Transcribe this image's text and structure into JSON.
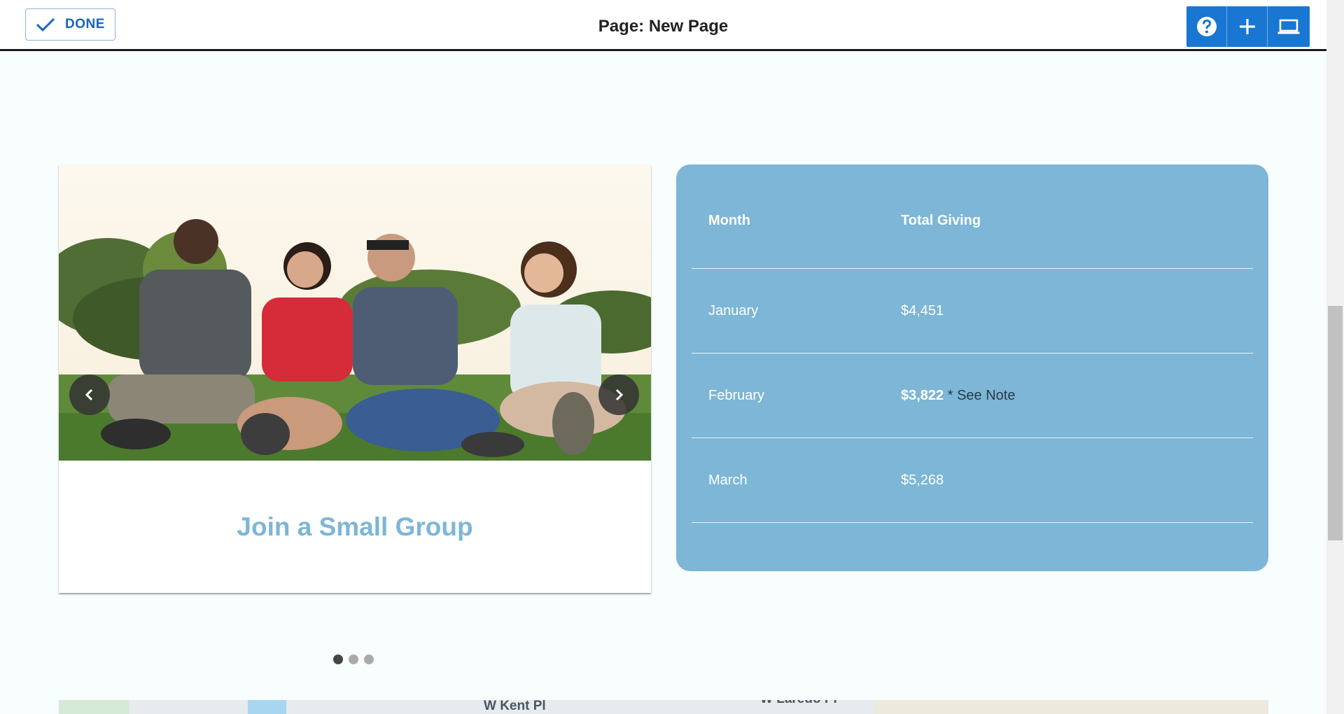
{
  "topbar": {
    "done_label": "DONE",
    "page_title": "Page: New Page",
    "tools": [
      "help-icon",
      "add-icon",
      "desktop-preview-icon"
    ],
    "accent_color": "#1976d2"
  },
  "carousel": {
    "caption": "Join a Small Group",
    "caption_color": "#7db6d6",
    "slide_count": 3,
    "active_slide": 1
  },
  "giving": {
    "headers": {
      "month": "Month",
      "total": "Total Giving"
    },
    "rows": [
      {
        "month": "January",
        "total": "$4,451",
        "note": ""
      },
      {
        "month": "February",
        "total": "$3,822",
        "note": "* See Note"
      },
      {
        "month": "March",
        "total": "$5,268",
        "note": ""
      }
    ],
    "background_color": "#7db6d6"
  },
  "map": {
    "labels": [
      "W Kent Pl",
      "W Laredo Pl"
    ]
  }
}
